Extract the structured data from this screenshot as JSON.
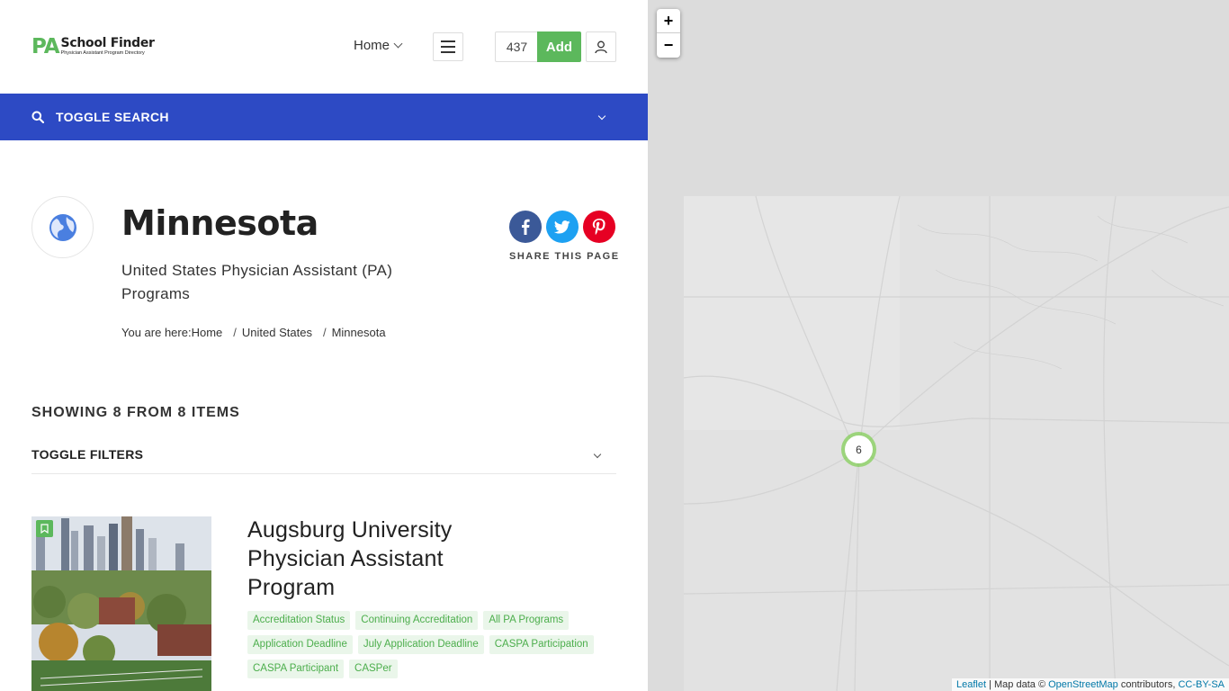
{
  "header": {
    "logo_pa": "PA",
    "logo_title": "School Finder",
    "logo_subtitle": "Physician Assistant Program Directory",
    "nav_home": "Home",
    "listing_count": "437",
    "add_label": "Add"
  },
  "search": {
    "toggle_label": "TOGGLE SEARCH"
  },
  "page": {
    "title": "Minnesota",
    "subtitle": "United States Physician Assistant (PA) Programs",
    "breadcrumb_prefix": "You are here:",
    "breadcrumb": [
      "Home",
      "United States",
      "Minnesota"
    ]
  },
  "share": {
    "label": "SHARE THIS PAGE",
    "icons": [
      "facebook-icon",
      "twitter-icon",
      "pinterest-icon"
    ],
    "colors": {
      "facebook": "#3b5998",
      "twitter": "#1da1f2",
      "pinterest": "#e60023"
    }
  },
  "results": {
    "showing_text": "SHOWING 8 FROM 8 ITEMS",
    "filters_label": "TOGGLE FILTERS"
  },
  "listing": {
    "title": "Augsburg University Physician Assistant Program",
    "tags": [
      "Accreditation Status",
      "Continuing Accreditation",
      "All PA Programs",
      "Application Deadline",
      "July Application Deadline",
      "CASPA Participation",
      "CASPA Participant",
      "CASPer"
    ]
  },
  "map": {
    "zoom_in": "+",
    "zoom_out": "−",
    "cluster_count": "6",
    "attribution": {
      "leaflet": "Leaflet",
      "map_data": "| Map data ©",
      "osm": "OpenStreetMap",
      "contributors": "contributors,",
      "license": "CC-BY-SA"
    }
  },
  "colors": {
    "accent_green": "#5cb85c",
    "search_bar_blue": "#2d4ac4",
    "tag_bg": "#eaf6ea",
    "map_bg": "#dcdcdc"
  }
}
